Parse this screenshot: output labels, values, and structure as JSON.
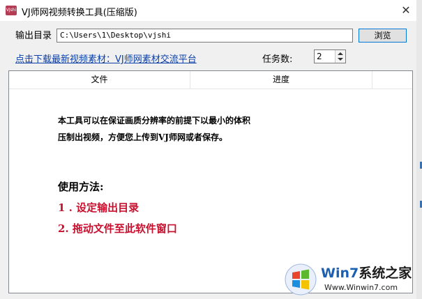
{
  "window": {
    "title": "VJ师网视频转换工具(压缩版)",
    "icon_label": "VJshi",
    "close_glyph": "✕"
  },
  "output": {
    "label": "输出目录",
    "path": "C:\\Users\\1\\Desktop\\vjshi",
    "browse_label": "浏览"
  },
  "download_link": "点击下载最新视频素材：VJ师网素材交流平台",
  "tasks": {
    "label": "任务数:",
    "value": "2"
  },
  "list": {
    "columns": [
      "文件",
      "进度"
    ],
    "description": [
      "本工具可以在保证画质分辨率的前提下以最小的体积",
      "压制出视频，方便您上传到VJ师网或者保存。"
    ],
    "usage_title": "使用方法:",
    "steps": [
      "1 . 设定输出目录",
      "2.  拖动文件至此软件窗口"
    ]
  },
  "watermark": {
    "brand": "Win7",
    "brand_suffix": "系统之家",
    "url": "Www.Winwin7.com"
  },
  "colors": {
    "link": "#0b3fa8",
    "steps": "#c8102e",
    "button_focus": "#0078d7"
  }
}
